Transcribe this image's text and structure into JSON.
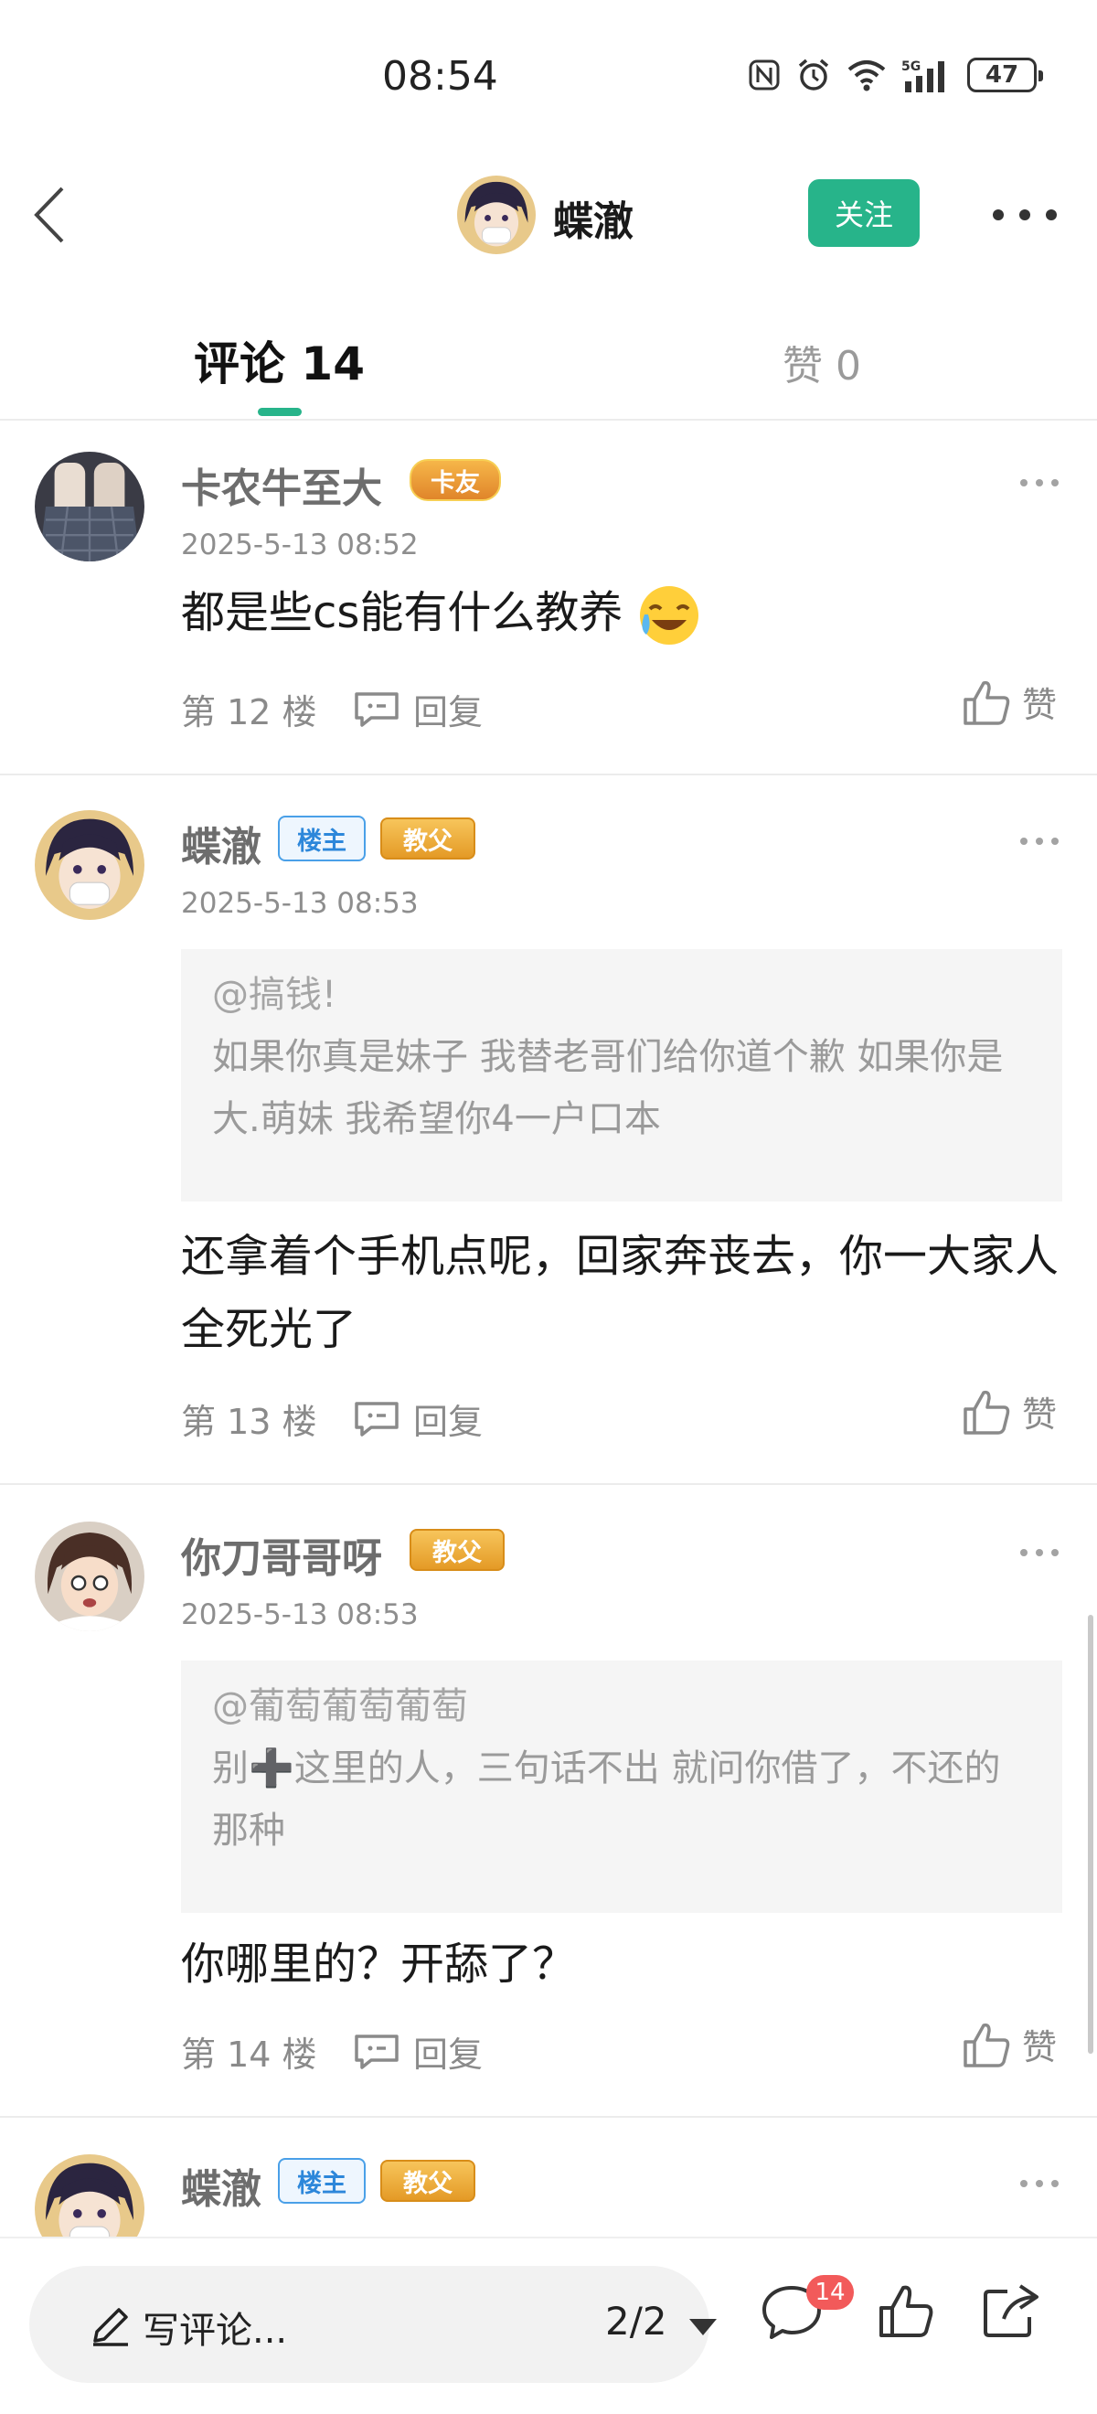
{
  "status_bar": {
    "time": "08:54",
    "battery": "47",
    "network": "5G"
  },
  "header": {
    "user_name": "蝶澈",
    "follow_label": "关注"
  },
  "tabs": {
    "comments_label": "评论 14",
    "likes_label": "赞 0"
  },
  "labels": {
    "reply": "回复",
    "like": "赞"
  },
  "comments": [
    {
      "author": "卡农牛至大",
      "badges": [
        "卡友"
      ],
      "time": "2025-5-13 08:52",
      "text": "都是些cs能有什么教养",
      "emoji": "crying-laughing-emoji",
      "floor": "第 12 楼"
    },
    {
      "author": "蝶澈",
      "badges": [
        "楼主",
        "教父"
      ],
      "time": "2025-5-13 08:53",
      "quote_user": "@搞钱!",
      "quote_text": "如果你真是妹子 我替老哥们给你道个歉 如果你是大.萌妹 我希望你4一户口本",
      "text": "还拿着个手机点呢，回家奔丧去，你一大家人全死光了",
      "floor": "第 13 楼"
    },
    {
      "author": "你刀哥哥呀",
      "badges": [
        "教父"
      ],
      "time": "2025-5-13 08:53",
      "quote_user": "@葡萄葡萄葡萄",
      "quote_text": "别➕这里的人，三句话不出 就问你借了，不还的那种",
      "text": "你哪里的？开舔了？",
      "floor": "第 14 楼"
    },
    {
      "author": "蝶澈",
      "badges": [
        "楼主",
        "教父"
      ]
    }
  ],
  "bottom_bar": {
    "write_placeholder": "写评论...",
    "page": "2/2",
    "comment_count": "14"
  },
  "colors": {
    "accent": "#27b48a",
    "owner_badge": "#2d87da",
    "crown_badge": "#e49a26",
    "notification": "#f25a5a"
  }
}
